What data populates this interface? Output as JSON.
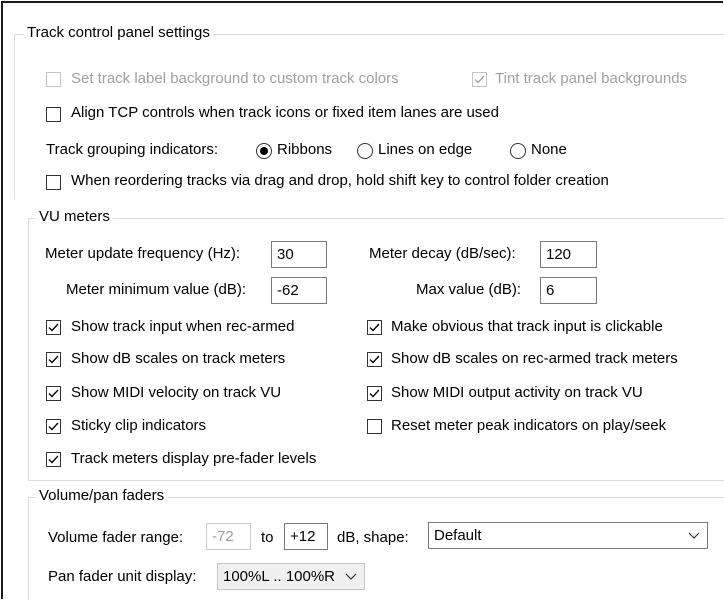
{
  "tcp": {
    "title": "Track control panel settings",
    "custom_colors_label": "Set track label background to custom track colors",
    "tint_backgrounds_label": "Tint track panel backgrounds",
    "align_controls_label": "Align TCP controls when track icons or fixed item lanes are used",
    "grouping_label": "Track grouping indicators:",
    "grouping_options": [
      "Ribbons",
      "Lines on edge",
      "None"
    ],
    "grouping_selected": "Ribbons",
    "reorder_label": "When reordering tracks via drag and drop, hold shift key to control folder creation"
  },
  "vu": {
    "title": "VU meters",
    "update_freq_label": "Meter update frequency (Hz):",
    "update_freq_value": "30",
    "decay_label": "Meter decay (dB/sec):",
    "decay_value": "120",
    "min_value_label": "Meter minimum value (dB):",
    "min_value_value": "-62",
    "max_value_label": "Max value (dB):",
    "max_value_value": "6",
    "options": {
      "show_input": "Show track input when rec-armed",
      "obvious_input": "Make obvious that track input is clickable",
      "db_scales": "Show dB scales on track meters",
      "db_scales_rec": "Show dB scales on rec-armed track meters",
      "midi_velocity": "Show MIDI velocity on track VU",
      "midi_output": "Show MIDI output activity on track VU",
      "sticky_clip": "Sticky clip indicators",
      "reset_peak": "Reset meter peak indicators on play/seek",
      "prefader": "Track meters display pre-fader levels"
    }
  },
  "vol": {
    "title": "Volume/pan faders",
    "range_label": "Volume fader range:",
    "range_min": "-72",
    "to_label": "to",
    "range_max": "+12",
    "shape_label": "dB, shape:",
    "shape_value": "Default",
    "pan_label": "Pan fader unit display:",
    "pan_value": "100%L .. 100%R"
  }
}
